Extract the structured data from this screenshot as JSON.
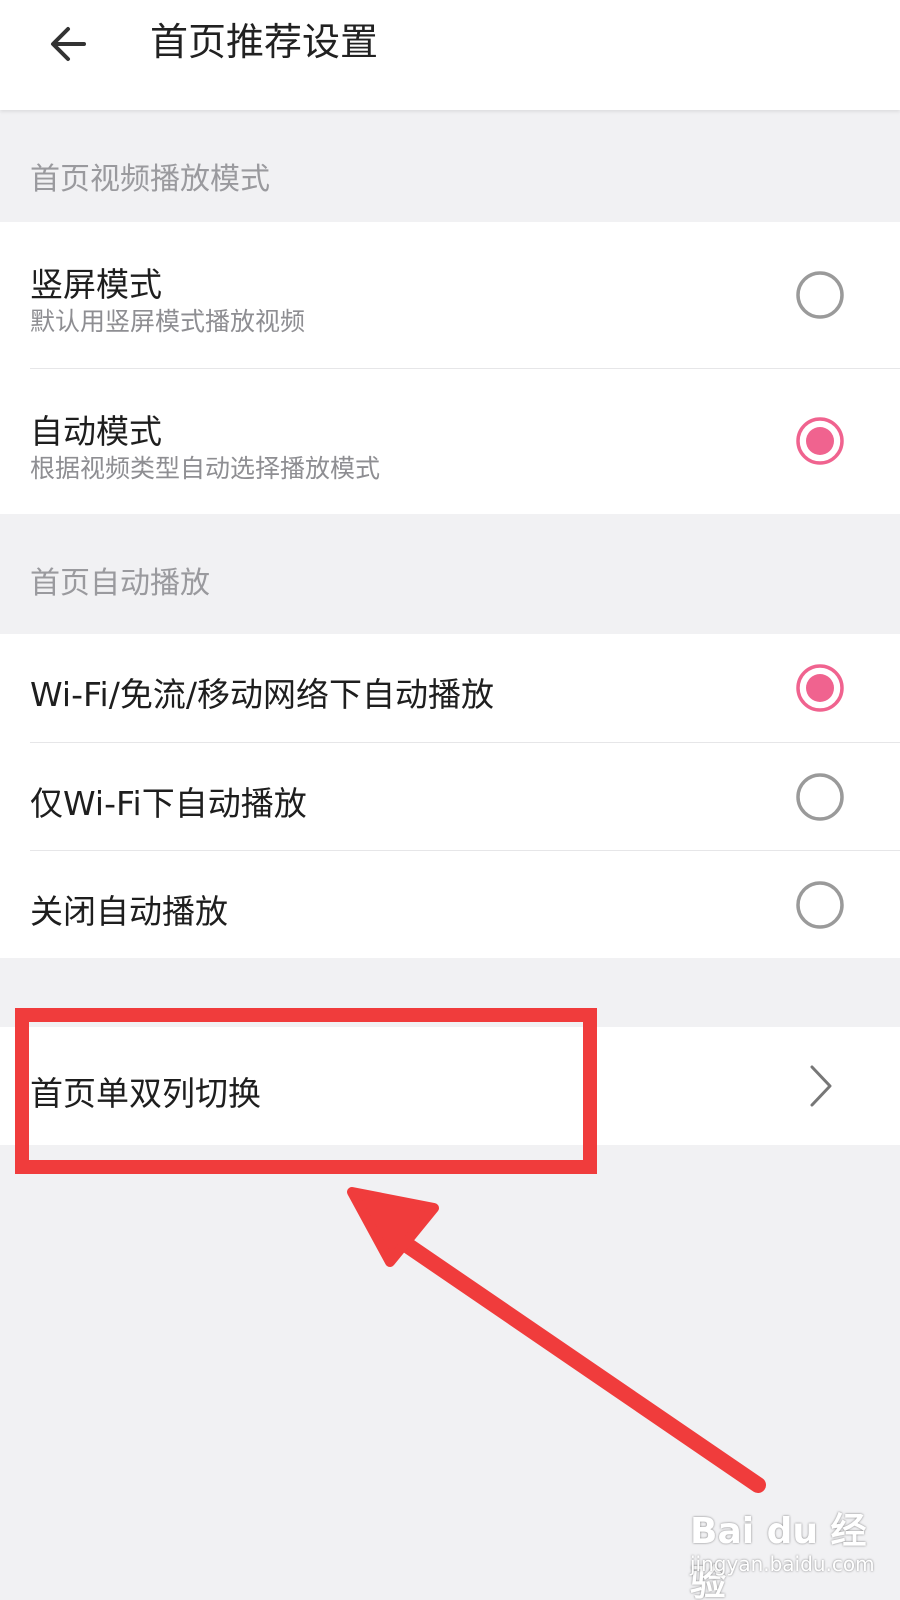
{
  "header": {
    "title": "首页推荐设置",
    "back_icon": "arrow-left-icon"
  },
  "sections": {
    "playback_mode": {
      "header": "首页视频播放模式",
      "items": [
        {
          "title": "竖屏模式",
          "subtitle": "默认用竖屏模式播放视频",
          "selected": false
        },
        {
          "title": "自动模式",
          "subtitle": "根据视频类型自动选择播放模式",
          "selected": true
        }
      ]
    },
    "autoplay": {
      "header": "首页自动播放",
      "items": [
        {
          "title": "Wi-Fi/免流/移动网络下自动播放",
          "selected": true
        },
        {
          "title": "仅Wi-Fi下自动播放",
          "selected": false
        },
        {
          "title": "关闭自动播放",
          "selected": false
        }
      ]
    },
    "layout": {
      "items": [
        {
          "title": "首页单双列切换",
          "icon": "chevron-right-icon"
        }
      ]
    }
  },
  "watermark": {
    "brand": "Bai du 经验",
    "url": "jingyan.baidu.com"
  },
  "colors": {
    "accent": "#f0638f",
    "annotation": "#f03c3c",
    "radio_off": "#9a9a9a",
    "background": "#f1f1f3"
  }
}
